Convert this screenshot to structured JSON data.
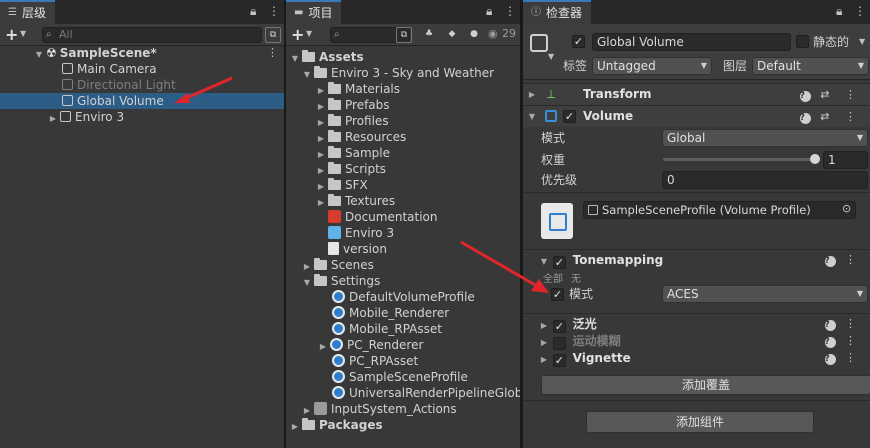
{
  "hierarchy": {
    "tab_label": "层级",
    "search_placeholder": "All",
    "items": [
      {
        "label": "SampleScene*"
      },
      {
        "label": "Main Camera"
      },
      {
        "label": "Directional Light"
      },
      {
        "label": "Global Volume"
      },
      {
        "label": "Enviro 3"
      }
    ]
  },
  "project": {
    "tab_label": "项目",
    "eye_count": "29",
    "items": [
      {
        "label": "Assets"
      },
      {
        "label": "Enviro 3 - Sky and Weather"
      },
      {
        "label": "Materials"
      },
      {
        "label": "Prefabs"
      },
      {
        "label": "Profiles"
      },
      {
        "label": "Resources"
      },
      {
        "label": "Sample"
      },
      {
        "label": "Scripts"
      },
      {
        "label": "SFX"
      },
      {
        "label": "Textures"
      },
      {
        "label": "Documentation"
      },
      {
        "label": "Enviro 3"
      },
      {
        "label": "version"
      },
      {
        "label": "Scenes"
      },
      {
        "label": "Settings"
      },
      {
        "label": "DefaultVolumeProfile"
      },
      {
        "label": "Mobile_Renderer"
      },
      {
        "label": "Mobile_RPAsset"
      },
      {
        "label": "PC_Renderer"
      },
      {
        "label": "PC_RPAsset"
      },
      {
        "label": "SampleSceneProfile"
      },
      {
        "label": "UniversalRenderPipelineGlobalSettings"
      },
      {
        "label": "InputSystem_Actions"
      },
      {
        "label": "Packages"
      }
    ]
  },
  "inspector": {
    "tab_label": "检查器",
    "object_name": "Global Volume",
    "static_label": "静态的",
    "tag_label": "标签",
    "tag_value": "Untagged",
    "layer_label": "图层",
    "layer_value": "Default",
    "transform_title": "Transform",
    "volume_title": "Volume",
    "mode_label": "模式",
    "mode_value": "Global",
    "weight_label": "权重",
    "weight_value": "1",
    "priority_label": "优先级",
    "priority_value": "0",
    "profile_value": "SampleSceneProfile (Volume Profile)",
    "tonemapping_title": "Tonemapping",
    "all_label": "全部",
    "none_label": "无",
    "tm_mode_label": "模式",
    "tm_mode_value": "ACES",
    "bloom_title": "泛光",
    "motion_blur_title": "运动模糊",
    "vignette_title": "Vignette",
    "add_override_label": "添加覆盖",
    "add_component_label": "添加组件"
  },
  "colors": {
    "selection": "#2c5d87",
    "annotation_arrow": "#e0262a",
    "tab_accent": "#3a79bb"
  }
}
